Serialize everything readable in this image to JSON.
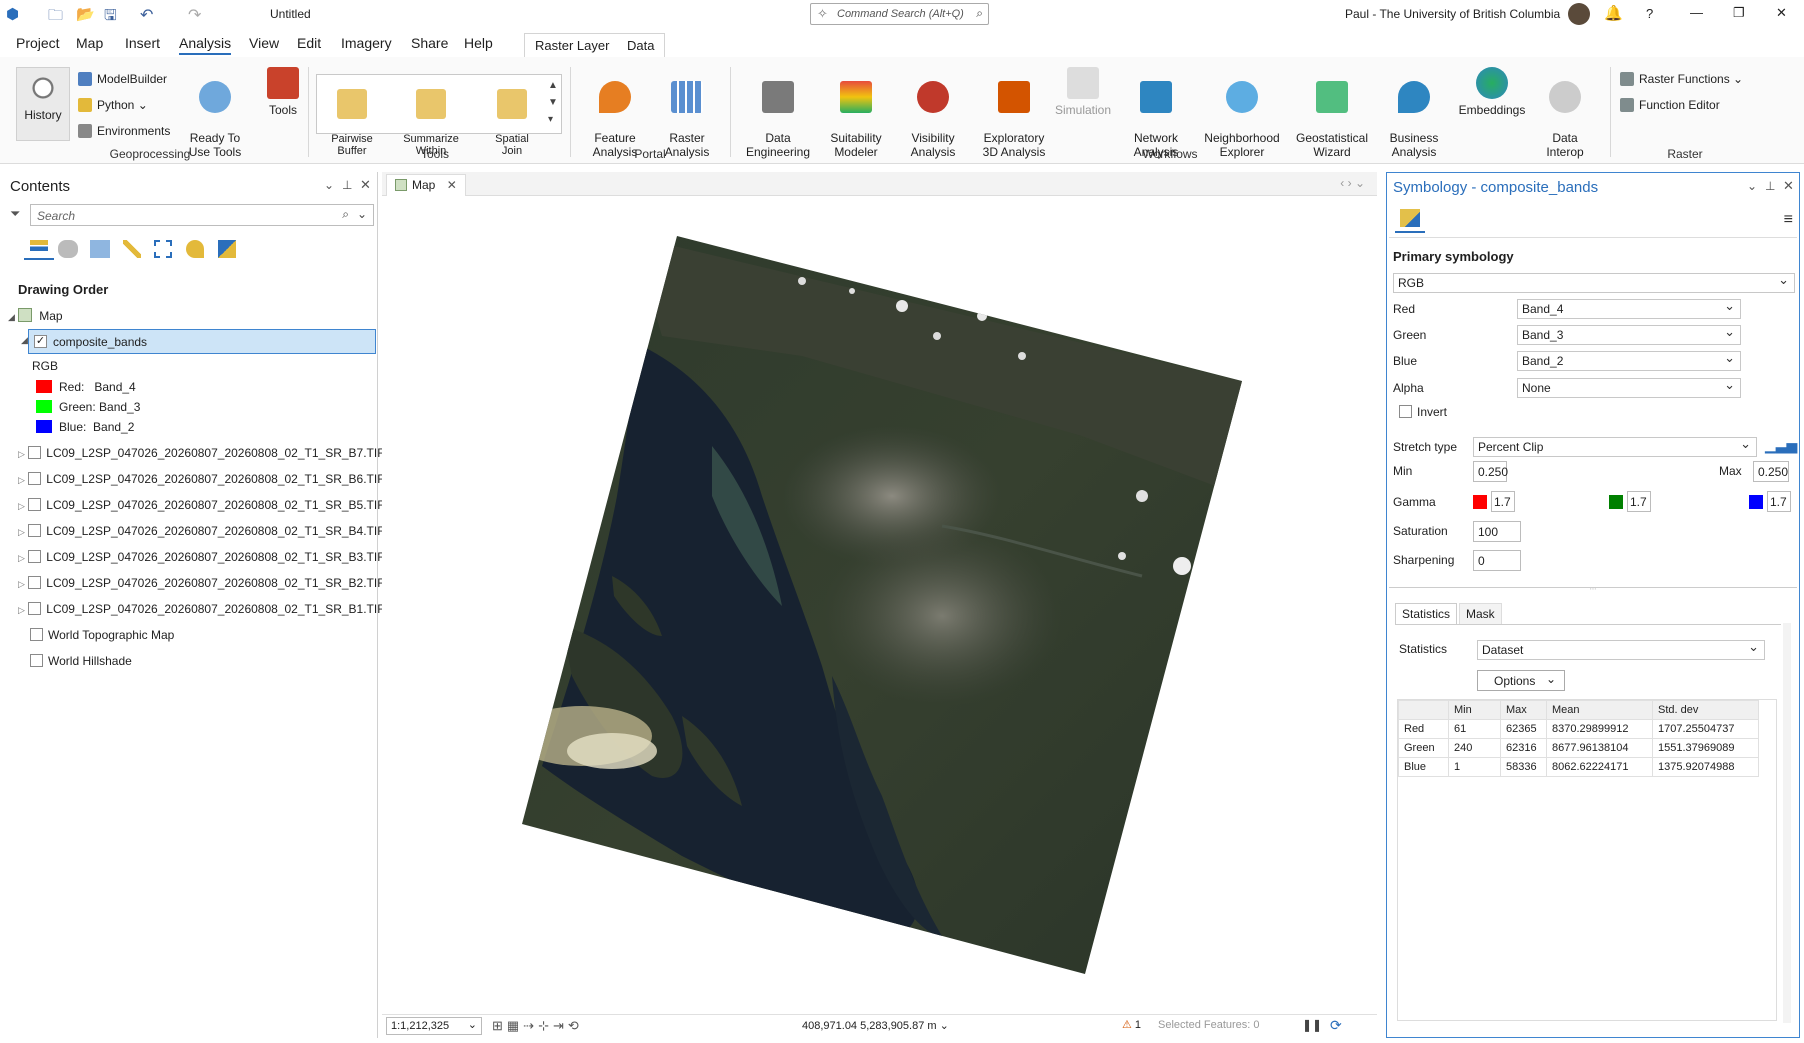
{
  "titlebar": {
    "doc_title": "Untitled",
    "search_placeholder": "Command Search (Alt+Q)",
    "user": "Paul - The University of British Columbia",
    "help": "?",
    "minimize": "—",
    "restore": "❐",
    "close": "✕"
  },
  "ribbon_tabs": [
    "Project",
    "Map",
    "Insert",
    "Analysis",
    "View",
    "Edit",
    "Imagery",
    "Share",
    "Help"
  ],
  "active_tab": "Analysis",
  "context_tabs": [
    "Raster Layer",
    "Data"
  ],
  "ribbon": {
    "history": "History",
    "modelbuilder": "ModelBuilder",
    "python": "Python",
    "environments": "Environments",
    "ready_to_use": "Ready To\nUse Tools",
    "tools": "Tools",
    "pairwise_buffer": "Pairwise\nBuffer",
    "summarize_within": "Summarize\nWithin",
    "spatial_join": "Spatial\nJoin",
    "feature_analysis": "Feature\nAnalysis",
    "raster_analysis": "Raster\nAnalysis",
    "data_engineering": "Data\nEngineering",
    "suitability_modeler": "Suitability\nModeler",
    "visibility_analysis": "Visibility\nAnalysis",
    "exploratory_3d": "Exploratory\n3D Analysis",
    "simulation": "Simulation",
    "network_analysis": "Network\nAnalysis",
    "neighborhood_explorer": "Neighborhood\nExplorer",
    "geostatistical_wizard": "Geostatistical\nWizard",
    "business_analysis": "Business\nAnalysis",
    "embeddings": "Embeddings",
    "data_interop": "Data\nInterop",
    "raster_functions": "Raster Functions",
    "function_editor": "Function Editor",
    "groups": {
      "geoprocessing": "Geoprocessing",
      "tools": "Tools",
      "portal": "Portal",
      "workflows": "Workflows",
      "raster": "Raster"
    }
  },
  "contents": {
    "title": "Contents",
    "search_placeholder": "Search",
    "drawing_order": "Drawing Order",
    "map_label": "Map",
    "selected_layer": "composite_bands",
    "renderer": "RGB",
    "legend": [
      {
        "label": "Red:   Band_4",
        "color": "#ff0000"
      },
      {
        "label": "Green: Band_3",
        "color": "#00ff00"
      },
      {
        "label": "Blue:  Band_2",
        "color": "#0000ff"
      }
    ],
    "layers": [
      "LC09_L2SP_047026_20260807_20260808_02_T1_SR_B7.TIF",
      "LC09_L2SP_047026_20260807_20260808_02_T1_SR_B6.TIF",
      "LC09_L2SP_047026_20260807_20260808_02_T1_SR_B5.TIF",
      "LC09_L2SP_047026_20260807_20260808_02_T1_SR_B4.TIF",
      "LC09_L2SP_047026_20260807_20260808_02_T1_SR_B3.TIF",
      "LC09_L2SP_047026_20260807_20260808_02_T1_SR_B2.TIF",
      "LC09_L2SP_047026_20260807_20260808_02_T1_SR_B1.TIF"
    ],
    "basemaps": [
      "World Topographic Map",
      "World Hillshade"
    ]
  },
  "map": {
    "tab_label": "Map",
    "scale": "1:1,212,325",
    "coords": "408,971.04 5,283,905.87 m",
    "warnings": "1",
    "selected_features": "Selected Features: 0"
  },
  "symbology": {
    "title": "Symbology - composite_bands",
    "primary": "Primary symbology",
    "renderer": "RGB",
    "red_label": "Red",
    "red_value": "Band_4",
    "green_label": "Green",
    "green_value": "Band_3",
    "blue_label": "Blue",
    "blue_value": "Band_2",
    "alpha_label": "Alpha",
    "alpha_value": "None",
    "invert": "Invert",
    "stretch_label": "Stretch type",
    "stretch_value": "Percent Clip",
    "min_label": "Min",
    "min_value": "0.250",
    "max_label": "Max",
    "max_value": "0.250",
    "gamma_label": "Gamma",
    "gamma": [
      "1.7",
      "1.7",
      "1.7"
    ],
    "gamma_colors": [
      "#ff0000",
      "#008000",
      "#0000ff"
    ],
    "saturation_label": "Saturation",
    "saturation_value": "100",
    "sharpening_label": "Sharpening",
    "sharpening_value": "0",
    "tabs": [
      "Statistics",
      "Mask"
    ],
    "statistics_label": "Statistics",
    "statistics_value": "Dataset",
    "options": "Options",
    "stats_header": [
      "",
      "Min",
      "Max",
      "Mean",
      "Std. dev"
    ],
    "stats_rows": [
      [
        "Red",
        "61",
        "62365",
        "8370.29899912",
        "1707.25504737"
      ],
      [
        "Green",
        "240",
        "62316",
        "8677.96138104",
        "1551.37969089"
      ],
      [
        "Blue",
        "1",
        "58336",
        "8062.62224171",
        "1375.92074988"
      ]
    ]
  }
}
